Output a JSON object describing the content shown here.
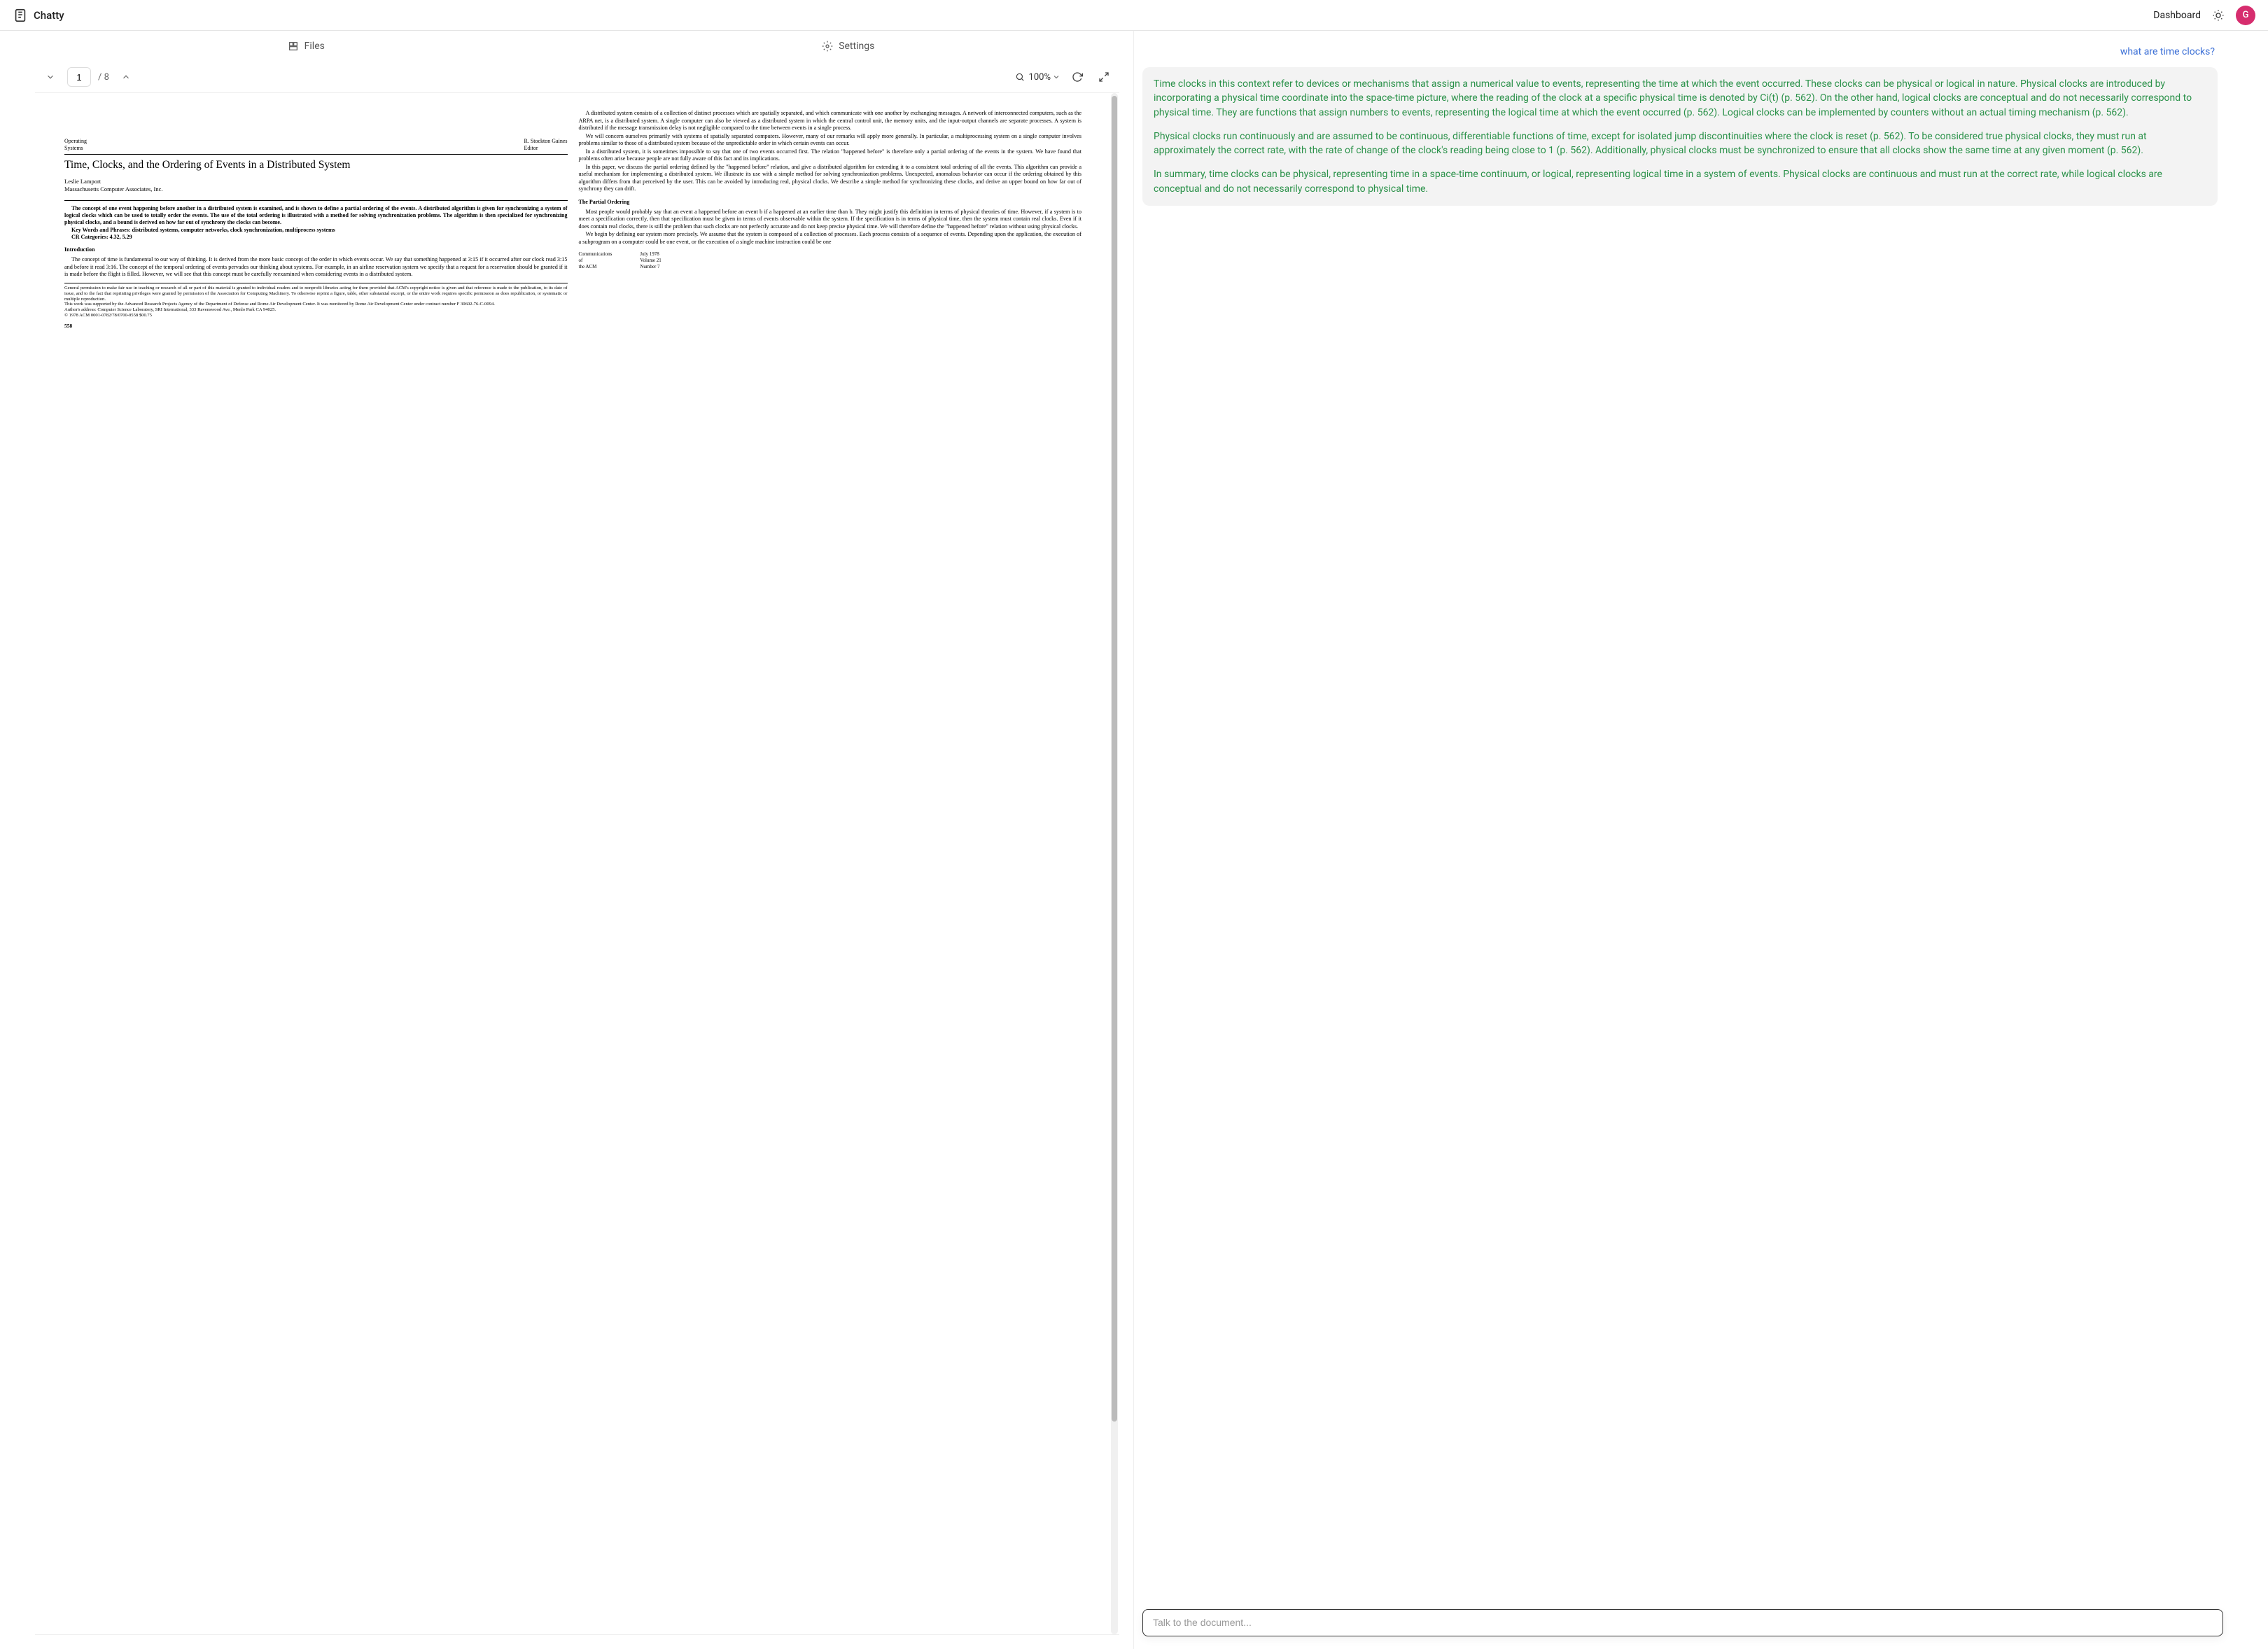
{
  "header": {
    "brand": "Chatty",
    "dashboard": "Dashboard",
    "avatar_initial": "G"
  },
  "tabs": {
    "files": "Files",
    "settings": "Settings"
  },
  "toolbar": {
    "page_current": "1",
    "page_total": "/ 8",
    "zoom": "100%"
  },
  "paper": {
    "header_left_l1": "Operating",
    "header_left_l2": "Systems",
    "header_right_l1": "R. Stockton Gaines",
    "header_right_l2": "Editor",
    "title": "Time, Clocks, and the Ordering of Events in a Distributed System",
    "author": "Leslie Lamport",
    "affiliation": "Massachusetts Computer Associates, Inc.",
    "abstract": "The concept of one event happening before another in a distributed system is examined, and is shown to define a partial ordering of the events. A distributed algorithm is given for synchronizing a system of logical clocks which can be used to totally order the events. The use of the total ordering is illustrated with a method for solving synchronization problems. The algorithm is then specialized for synchronizing physical clocks, and a bound is derived on how far out of synchrony the clocks can become.",
    "keywords": "Key Words and Phrases: distributed systems, computer networks, clock synchronization, multiprocess systems",
    "cr": "CR Categories: 4.32, 5.29",
    "intro_h": "Introduction",
    "intro_p1": "The concept of time is fundamental to our way of thinking. It is derived from the more basic concept of the order in which events occur. We say that something happened at 3:15 if it occurred after our clock read 3:15 and before it read 3:16. The concept of the temporal ordering of events pervades our thinking about systems. For example, in an airline reservation system we specify that a request for a reservation should be granted if it is made before the flight is filled. However, we will see that this concept must be carefully reexamined when considering events in a distributed system.",
    "footnote": "General permission to make fair use in teaching or research of all or part of this material is granted to individual readers and to nonprofit libraries acting for them provided that ACM's copyright notice is given and that reference is made to the publication, to its date of issue, and to the fact that reprinting privileges were granted by permission of the Association for Computing Machinery. To otherwise reprint a figure, table, other substantial excerpt, or the entire work requires specific permission as does republication, or systematic or multiple reproduction.\nThis work was supported by the Advanced Research Projects Agency of the Department of Defense and Rome Air Development Center. It was monitored by Rome Air Development Center under contract number F 30602-76-C-0094.\nAuthor's address: Computer Science Laboratory, SRI International, 333 Ravenswood Ave., Menlo Park CA 94025.\n© 1978 ACM 0001-0782/78/0700-0558 $00.75",
    "page_num": "558",
    "col2_p1": "A distributed system consists of a collection of distinct processes which are spatially separated, and which communicate with one another by exchanging messages. A network of interconnected computers, such as the ARPA net, is a distributed system. A single computer can also be viewed as a distributed system in which the central control unit, the memory units, and the input-output channels are separate processes. A system is distributed if the message transmission delay is not negligible compared to the time between events in a single process.",
    "col2_p2": "We will concern ourselves primarily with systems of spatially separated computers. However, many of our remarks will apply more generally. In particular, a multiprocessing system on a single computer involves problems similar to those of a distributed system because of the unpredictable order in which certain events can occur.",
    "col2_p3": "In a distributed system, it is sometimes impossible to say that one of two events occurred first. The relation \"happened before\" is therefore only a partial ordering of the events in the system. We have found that problems often arise because people are not fully aware of this fact and its implications.",
    "col2_p4": "In this paper, we discuss the partial ordering defined by the \"happened before\" relation, and give a distributed algorithm for extending it to a consistent total ordering of all the events. This algorithm can provide a useful mechanism for implementing a distributed system. We illustrate its use with a simple method for solving synchronization problems. Unexpected, anomalous behavior can occur if the ordering obtained by this algorithm differs from that perceived by the user. This can be avoided by introducing real, physical clocks. We describe a simple method for synchronizing these clocks, and derive an upper bound on how far out of synchrony they can drift.",
    "partial_h": "The Partial Ordering",
    "col2_p5": "Most people would probably say that an event a happened before an event b if a happened at an earlier time than b. They might justify this definition in terms of physical theories of time. However, if a system is to meet a specification correctly, then that specification must be given in terms of events observable within the system. If the specification is in terms of physical time, then the system must contain real clocks. Even if it does contain real clocks, there is still the problem that such clocks are not perfectly accurate and do not keep precise physical time. We will therefore define the \"happened before\" relation without using physical clocks.",
    "col2_p6": "We begin by defining our system more precisely. We assume that the system is composed of a collection of processes. Each process consists of a sequence of events. Depending upon the application, the execution of a subprogram on a computer could be one event, or the execution of a single machine instruction could be one",
    "footer_c1_l1": "Communications",
    "footer_c1_l2": "of",
    "footer_c1_l3": "the ACM",
    "footer_c2_l1": "July 1978",
    "footer_c2_l2": "Volume 21",
    "footer_c2_l3": "Number 7"
  },
  "chat": {
    "user_msg": "what are time clocks?",
    "assistant_p1": "Time clocks in this context refer to devices or mechanisms that assign a numerical value to events, representing the time at which the event occurred. These clocks can be physical or logical in nature. Physical clocks are introduced by incorporating a physical time coordinate into the space-time picture, where the reading of the clock at a specific physical time is denoted by Ci(t) (p. 562). On the other hand, logical clocks are conceptual and do not necessarily correspond to physical time. They are functions that assign numbers to events, representing the logical time at which the event occurred (p. 562). Logical clocks can be implemented by counters without an actual timing mechanism (p. 562).",
    "assistant_p2": "Physical clocks run continuously and are assumed to be continuous, differentiable functions of time, except for isolated jump discontinuities where the clock is reset (p. 562). To be considered true physical clocks, they must run at approximately the correct rate, with the rate of change of the clock's reading being close to 1 (p. 562). Additionally, physical clocks must be synchronized to ensure that all clocks show the same time at any given moment (p. 562).",
    "assistant_p3": "In summary, time clocks can be physical, representing time in a space-time continuum, or logical, representing logical time in a system of events. Physical clocks are continuous and must run at the correct rate, while logical clocks are conceptual and do not necessarily correspond to physical time."
  },
  "input": {
    "placeholder": "Talk to the document..."
  }
}
